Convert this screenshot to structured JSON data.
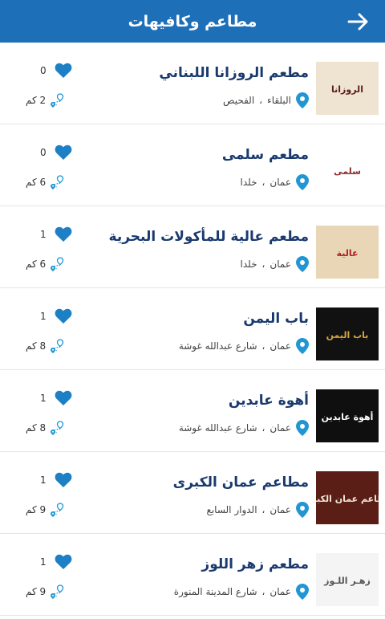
{
  "header": {
    "title": "مطاعم وكافيهات",
    "back_icon": "arrow-right-icon"
  },
  "colors": {
    "header_bg": "#1d6fb8",
    "accent": "#2196d3",
    "name": "#1a3a6e"
  },
  "restaurants": [
    {
      "name": "مطعم الروزانا اللبناني",
      "city": "البلقاء",
      "area": "الفحيص",
      "likes": "0",
      "distance": "2 كم",
      "logo_text": "الروزانا",
      "logo_bg": "#efe4d2",
      "logo_fg": "#5a1a1a"
    },
    {
      "name": "مطعم سلمى",
      "city": "عمان",
      "area": "خلدا",
      "likes": "0",
      "distance": "6 كم",
      "logo_text": "سلمى",
      "logo_bg": "#ffffff",
      "logo_fg": "#8a2b2b"
    },
    {
      "name": "مطعم عالية للمأكولات البحرية",
      "city": "عمان",
      "area": "خلدا",
      "likes": "1",
      "distance": "6 كم",
      "logo_text": "عالية",
      "logo_bg": "#e8d6b6",
      "logo_fg": "#b02020"
    },
    {
      "name": "باب اليمن",
      "city": "عمان",
      "area": "شارع عبدالله غوشة",
      "likes": "1",
      "distance": "8 كم",
      "logo_text": "باب اليمن",
      "logo_bg": "#111111",
      "logo_fg": "#d8a53a"
    },
    {
      "name": "أهوة عابدين",
      "city": "عمان",
      "area": "شارع عبدالله غوشة",
      "likes": "1",
      "distance": "8 كم",
      "logo_text": "أهوة عابدين",
      "logo_bg": "#0f0f0f",
      "logo_fg": "#ffffff"
    },
    {
      "name": "مطاعم عمان الكبرى",
      "city": "عمان",
      "area": "الدوار السابع",
      "likes": "1",
      "distance": "9 كم",
      "logo_text": "مطاعم عمان الكبرى",
      "logo_bg": "#5a1e16",
      "logo_fg": "#f0e6d8"
    },
    {
      "name": "مطعم زهر اللوز",
      "city": "عمان",
      "area": "شارع المدينة المنورة",
      "likes": "1",
      "distance": "9 كم",
      "logo_text": "زهـر اللـوز",
      "logo_bg": "#f4f4f4",
      "logo_fg": "#555555"
    }
  ]
}
